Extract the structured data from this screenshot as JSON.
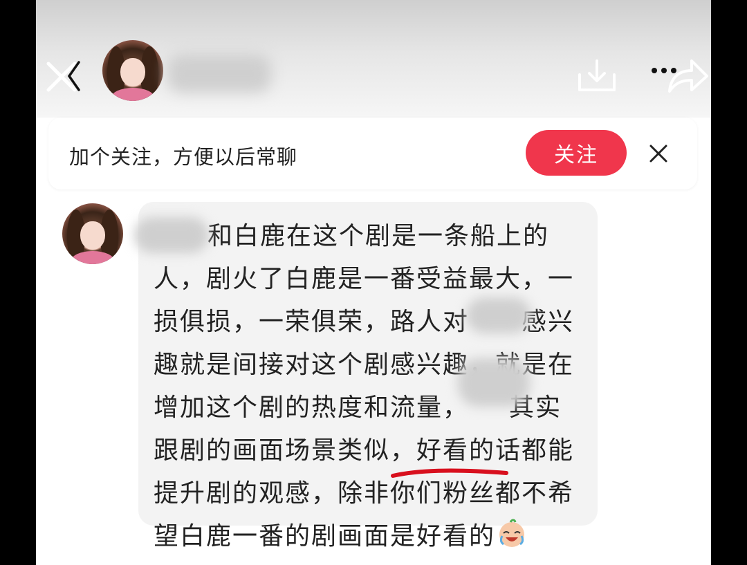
{
  "header": {
    "back_icon": "chevron-left-icon",
    "close_icon": "close-icon",
    "download_icon": "download-icon",
    "more_icon": "more-icon",
    "share_icon": "share-icon"
  },
  "follow_banner": {
    "text": "加个关注，方便以后常聊",
    "button_label": "关注",
    "button_color": "#f0364c",
    "dismiss_icon": "close-icon"
  },
  "message": {
    "lines": [
      "和白鹿在这个剧是一条船上的",
      "人，剧火了白鹿是一番受益最大，一",
      "损俱损，一荣俱荣，路人对　　感兴",
      "趣就是间接对这个剧感兴趣，就是在",
      "增加这个剧的热度和流量，　　其实",
      "跟剧的画面场景类似，好看的话都能",
      "提升剧的观感，除非你们粉丝都不希",
      "望白鹿一番的剧画面是好看的"
    ],
    "emoji_icon": "crying-laughing-emoji-icon",
    "underline_color": "#d8101e"
  }
}
